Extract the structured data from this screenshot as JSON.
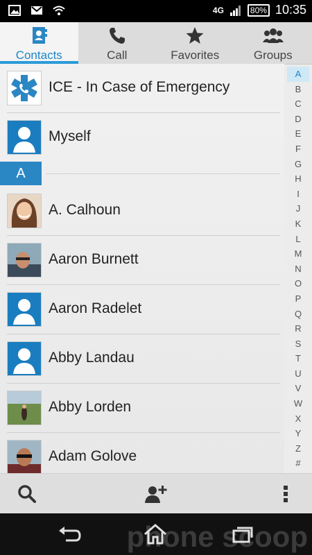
{
  "status": {
    "network": "4G",
    "battery": "80%",
    "time": "10:35"
  },
  "tabs": [
    {
      "label": "Contacts",
      "icon": "contacts-book-icon",
      "active": true
    },
    {
      "label": "Call",
      "icon": "phone-icon",
      "active": false
    },
    {
      "label": "Favorites",
      "icon": "star-icon",
      "active": false
    },
    {
      "label": "Groups",
      "icon": "group-icon",
      "active": false
    }
  ],
  "contacts": {
    "pinned": [
      {
        "name": "ICE - In Case of Emergency",
        "avatar": "ice-icon"
      },
      {
        "name": "Myself",
        "avatar": "person-placeholder-icon"
      }
    ],
    "section_letter": "A",
    "items": [
      {
        "name": "A. Calhoun",
        "avatar": "photo"
      },
      {
        "name": "Aaron Burnett",
        "avatar": "photo"
      },
      {
        "name": "Aaron Radelet",
        "avatar": "person-placeholder-icon"
      },
      {
        "name": "Abby Landau",
        "avatar": "person-placeholder-icon"
      },
      {
        "name": "Abby Lorden",
        "avatar": "photo"
      },
      {
        "name": "Adam Golove",
        "avatar": "photo"
      }
    ]
  },
  "alphabet": [
    "A",
    "B",
    "C",
    "D",
    "E",
    "F",
    "G",
    "H",
    "I",
    "J",
    "K",
    "L",
    "M",
    "N",
    "O",
    "P",
    "Q",
    "R",
    "S",
    "T",
    "U",
    "V",
    "W",
    "X",
    "Y",
    "Z",
    "#"
  ],
  "actions": {
    "search": "search-icon",
    "add_contact": "add-contact-icon",
    "overflow": "overflow-menu-icon"
  },
  "watermark": "phone scoop",
  "colors": {
    "accent": "#2b86c4",
    "tab_highlight": "#2b9bd8"
  }
}
